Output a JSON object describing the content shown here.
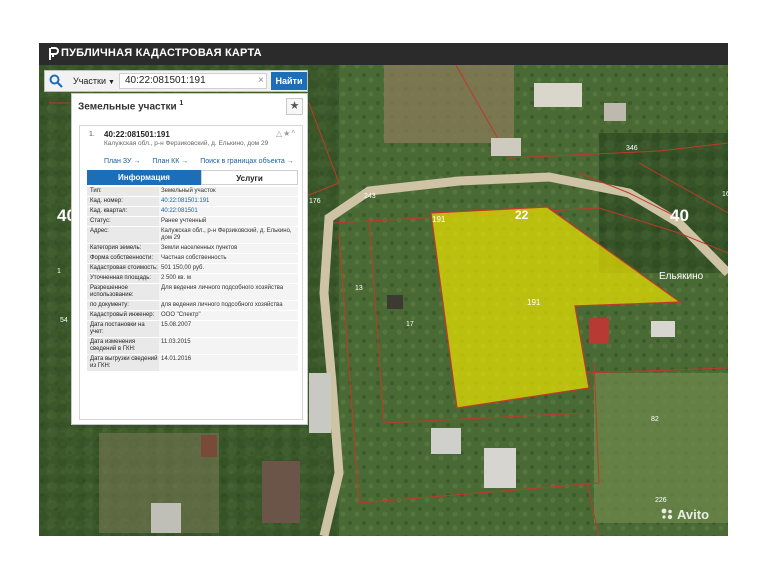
{
  "app": {
    "title": "ПУБЛИЧНАЯ КАДАСТРОВАЯ КАРТА"
  },
  "search": {
    "category": "Участки",
    "query": "40:22:081501:191",
    "button": "Найти"
  },
  "panel": {
    "heading": "Земельные участки",
    "count": "1",
    "result": {
      "index": "1.",
      "cadastral_number": "40:22:081501:191",
      "address": "Калужская обл., р-н Ферзиковский, д. Елькино, дом 29",
      "links": [
        "План ЗУ →",
        "План КК →",
        "Поиск в границах объекта →"
      ]
    },
    "tabs": {
      "active": "Информация",
      "other": "Услуги"
    },
    "rows": [
      {
        "key": "Тип:",
        "value": "Земельный участок"
      },
      {
        "key": "Кад. номер:",
        "value": "40:22:081501:191",
        "link": true
      },
      {
        "key": "Кад. квартал:",
        "value": "40:22:081501",
        "link": true
      },
      {
        "key": "Статус:",
        "value": "Ранее учтенный"
      },
      {
        "key": "Адрес:",
        "value": "Калужская обл., р-н Ферзиковский, д. Елькино, дом 29"
      },
      {
        "key": "Категория земель:",
        "value": "Земли населенных пунктов"
      },
      {
        "key": "Форма собственности:",
        "value": "Частная собственность"
      },
      {
        "key": "Кадастровая стоимость:",
        "value": "501 150,00 руб."
      },
      {
        "key": "Уточненная площадь:",
        "value": "2 500 кв. м"
      },
      {
        "key": "Разрешенное использование:",
        "value": "Для ведения личного подсобного хозяйства"
      },
      {
        "key": "по документу:",
        "value": "для ведения личного подсобного хозяйства"
      },
      {
        "key": "Кадастровый инженер:",
        "value": "ООО \"Спектр\""
      },
      {
        "key": "Дата постановки на учет:",
        "value": "15.08.2007"
      },
      {
        "key": "Дата изменения сведений в ГКН:",
        "value": "11.03.2015"
      },
      {
        "key": "Дата выгрузки сведений из ГКН:",
        "value": "14.01.2016"
      }
    ]
  },
  "map": {
    "labels": {
      "q40_left": "40",
      "q40_right": "40",
      "parcel_22": "22",
      "parcel_191_top": "191",
      "parcel_191": "191",
      "village": "Ельякино",
      "p13a": "13",
      "p17": "17",
      "p243": "243",
      "p346": "346",
      "p226": "226",
      "p82": "82",
      "p16": "16",
      "p54": "54",
      "p176": "176",
      "p1": "1"
    },
    "colors": {
      "parcel_fill": "#e8e000",
      "boundary": "#c0392b",
      "road": "#cfc3a6"
    }
  },
  "watermark": "Avito"
}
